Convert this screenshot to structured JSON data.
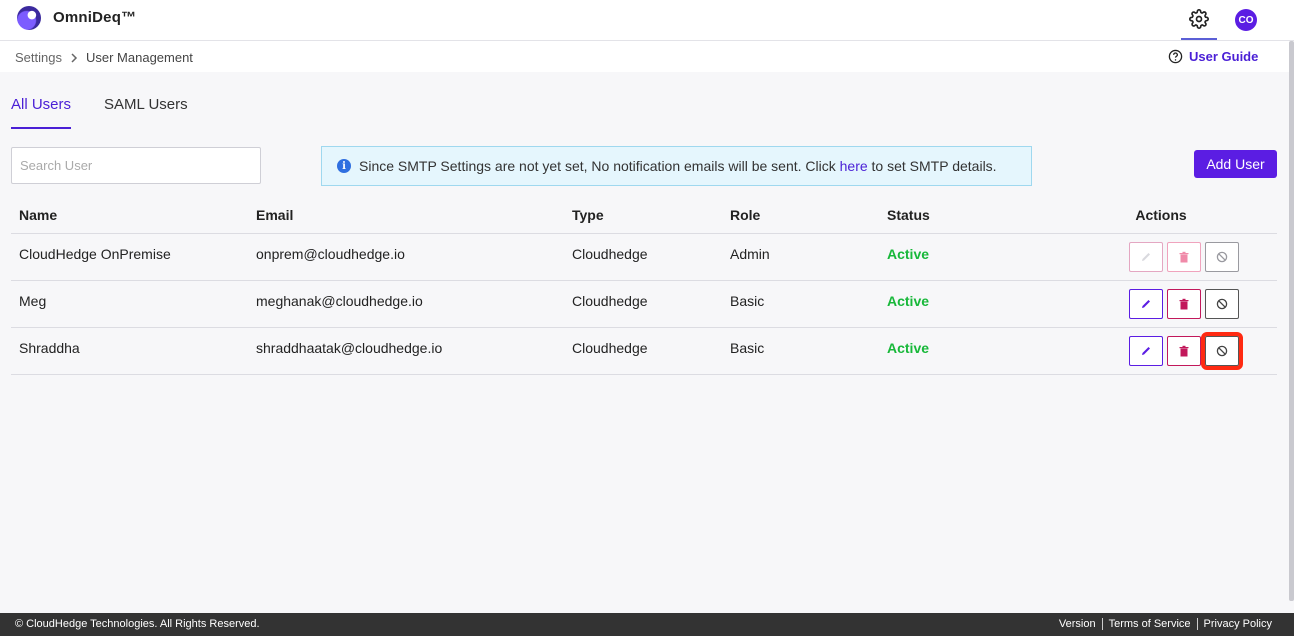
{
  "app": {
    "title": "OmniDeq™",
    "avatar_initials": "CO"
  },
  "breadcrumb": {
    "parent": "Settings",
    "current": "User Management"
  },
  "header": {
    "user_guide": "User Guide"
  },
  "tabs": [
    {
      "label": "All Users",
      "active": true
    },
    {
      "label": "SAML Users",
      "active": false
    }
  ],
  "search": {
    "placeholder": "Search User",
    "value": ""
  },
  "notice": {
    "text_before": "Since SMTP Settings are not yet set, No notification emails will be sent. Click",
    "link": "here",
    "text_after": "to set SMTP details."
  },
  "add_user_label": "Add User",
  "table": {
    "columns": [
      "Name",
      "Email",
      "Type",
      "Role",
      "Status",
      "Actions"
    ],
    "rows": [
      {
        "name": "CloudHedge OnPremise",
        "email": "onprem@cloudhedge.io",
        "type": "Cloudhedge",
        "role": "Admin",
        "status": "Active",
        "actions_disabled": true
      },
      {
        "name": "Meg",
        "email": "meghanak@cloudhedge.io",
        "type": "Cloudhedge",
        "role": "Basic",
        "status": "Active",
        "actions_disabled": false
      },
      {
        "name": "Shraddha",
        "email": "shraddhaatak@cloudhedge.io",
        "type": "Cloudhedge",
        "role": "Basic",
        "status": "Active",
        "actions_disabled": false
      }
    ]
  },
  "footer": {
    "copyright": "© CloudHedge Technologies. All Rights Reserved.",
    "links": [
      "Version",
      "Terms of Service",
      "Privacy Policy"
    ]
  },
  "colors": {
    "accent": "#5b1de3",
    "active": "#18b83a",
    "delete": "#c2185b",
    "highlight": "#ff2a12"
  }
}
